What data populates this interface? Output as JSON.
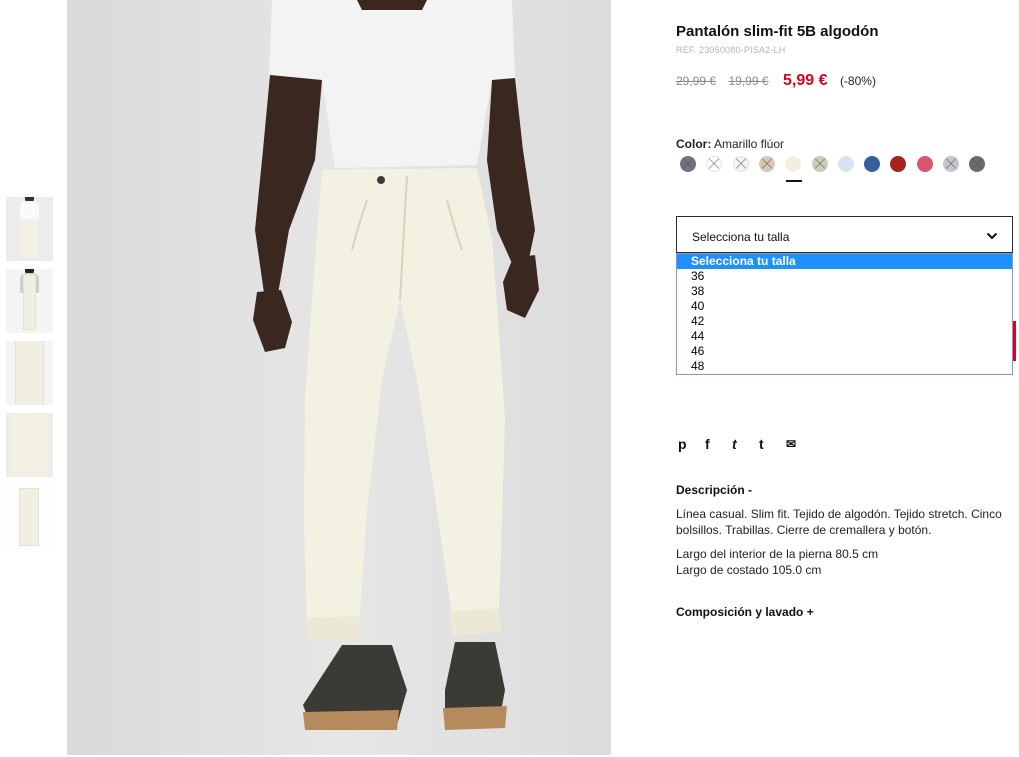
{
  "product": {
    "title": "Pantalón slim-fit 5B algodón",
    "ref": "REF. 23050080-PISA2-LH",
    "price_original": "29,99 €",
    "price_previous": "19,99 €",
    "price_current": "5,99 €",
    "discount": "(-80%)"
  },
  "color": {
    "label": "Color:",
    "selected": "Amarillo flúor",
    "swatches": [
      {
        "name": "swatch-grey-dark",
        "hex": "#6f7480",
        "crossed": true
      },
      {
        "name": "swatch-white-1",
        "hex": "#ffffff",
        "crossed": true
      },
      {
        "name": "swatch-white-2",
        "hex": "#f4f4f4",
        "crossed": true
      },
      {
        "name": "swatch-beige",
        "hex": "#d9c9b4",
        "crossed": true
      },
      {
        "name": "swatch-cream",
        "hex": "#f1efdf",
        "crossed": false
      },
      {
        "name": "swatch-sage",
        "hex": "#c7cfb6",
        "crossed": true
      },
      {
        "name": "swatch-light-blue",
        "hex": "#d7e4f2",
        "crossed": false
      },
      {
        "name": "swatch-blue",
        "hex": "#35609a",
        "crossed": false
      },
      {
        "name": "swatch-red",
        "hex": "#a5231f",
        "crossed": false
      },
      {
        "name": "swatch-pink",
        "hex": "#d9566d",
        "crossed": false
      },
      {
        "name": "swatch-light-grey",
        "hex": "#c4c6c9",
        "crossed": true
      },
      {
        "name": "swatch-charcoal",
        "hex": "#6c6c6c",
        "crossed": true
      }
    ]
  },
  "size": {
    "placeholder": "Selecciona tu talla",
    "options": [
      "Selecciona tu talla",
      "36",
      "38",
      "40",
      "42",
      "44",
      "46",
      "48"
    ]
  },
  "share": {
    "icons": [
      {
        "name": "pinterest-icon",
        "glyph": "p"
      },
      {
        "name": "facebook-icon",
        "glyph": "f"
      },
      {
        "name": "twitter-icon",
        "glyph": "t"
      },
      {
        "name": "tumblr-icon",
        "glyph": "t"
      },
      {
        "name": "email-icon",
        "glyph": "✉"
      }
    ]
  },
  "description": {
    "heading": "Descripción  -",
    "text": "Línea casual. Slim fit. Tejido de algodón. Tejido stretch. Cinco bolsillos. Trabillas. Cierre de cremallera y botón.",
    "inseam": "Largo del interior de la pierna 80.5 cm",
    "outseam": "Largo de costado 105.0 cm"
  },
  "composition": {
    "heading": "Composición y lavado  +"
  },
  "colors": {
    "sale_red": "#e0001b",
    "select_highlight": "#1e90ff"
  }
}
